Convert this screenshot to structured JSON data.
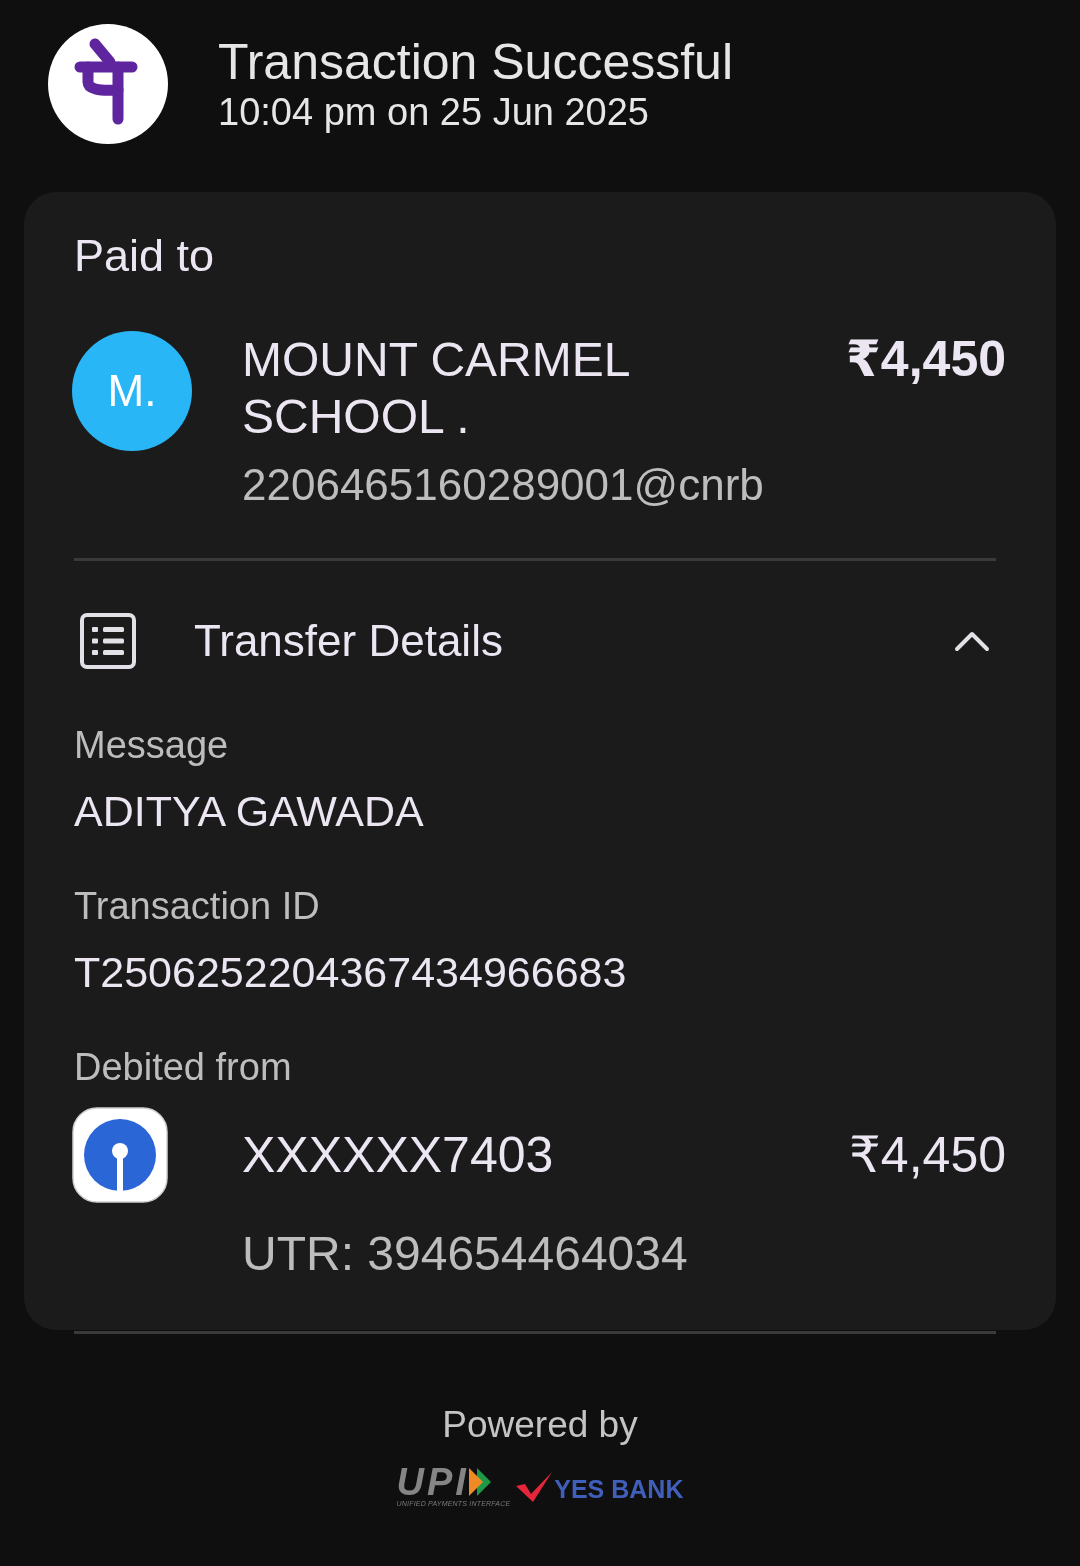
{
  "header": {
    "title": "Transaction Successful",
    "timestamp": "10:04 pm on 25 Jun 2025"
  },
  "paid_to": {
    "label": "Paid to",
    "payee": {
      "initials": "M.",
      "name": "MOUNT CARMEL SCHOOL .",
      "upi_id": "2206465160289001@cnrb",
      "amount": "₹4,450"
    }
  },
  "transfer_details": {
    "title": "Transfer Details",
    "expanded": true,
    "fields": [
      {
        "label": "Message",
        "value": "ADITYA GAWADA"
      },
      {
        "label": "Transaction ID",
        "value": "T2506252204367434966683"
      }
    ],
    "debited_from": {
      "label": "Debited from",
      "account": "XXXXXX7403",
      "amount": "₹4,450",
      "utr": "UTR: 394654464034"
    }
  },
  "footer": {
    "powered_by": "Powered by",
    "logos": [
      {
        "kind": "upi",
        "wordmark": "UPI",
        "tagline": "UNIFIED PAYMENTS INTERFACE"
      },
      {
        "kind": "bank",
        "wordmark": "YES BANK"
      }
    ]
  }
}
